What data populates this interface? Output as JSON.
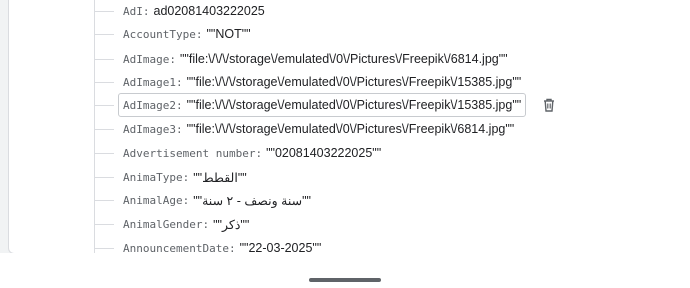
{
  "fields": [
    {
      "key": "AdI",
      "value": "ad02081403222025"
    },
    {
      "key": "AccountType",
      "value": "\"\"NOT\"\""
    },
    {
      "key": "AdImage",
      "value": "\"\"file:\\/\\/\\/storage\\/emulated\\/0\\/Pictures\\/Freepik\\/6814.jpg\"\""
    },
    {
      "key": "AdImage1",
      "value": "\"\"file:\\/\\/\\/storage\\/emulated\\/0\\/Pictures\\/Freepik\\/15385.jpg\"\""
    },
    {
      "key": "AdImage2",
      "value": "\"\"file:\\/\\/\\/storage\\/emulated\\/0\\/Pictures\\/Freepik\\/15385.jpg\"\""
    },
    {
      "key": "AdImage3",
      "value": "\"\"file:\\/\\/\\/storage\\/emulated\\/0\\/Pictures\\/Freepik\\/6814.jpg\"\""
    },
    {
      "key": "Advertisement number",
      "value": "\"\"02081403222025\"\""
    },
    {
      "key": "AnimaType",
      "value": "\"\"القطط\"\""
    },
    {
      "key": "AnimalAge",
      "value": "\"\"سنة ونصف - ٢ سنة\"\""
    },
    {
      "key": "AnimalGender",
      "value": "\"\"ذكر\"\""
    },
    {
      "key": "AnnouncementDate",
      "value": "\"\"22-03-2025\"\""
    }
  ],
  "icons": {
    "delete": "trash-icon"
  }
}
